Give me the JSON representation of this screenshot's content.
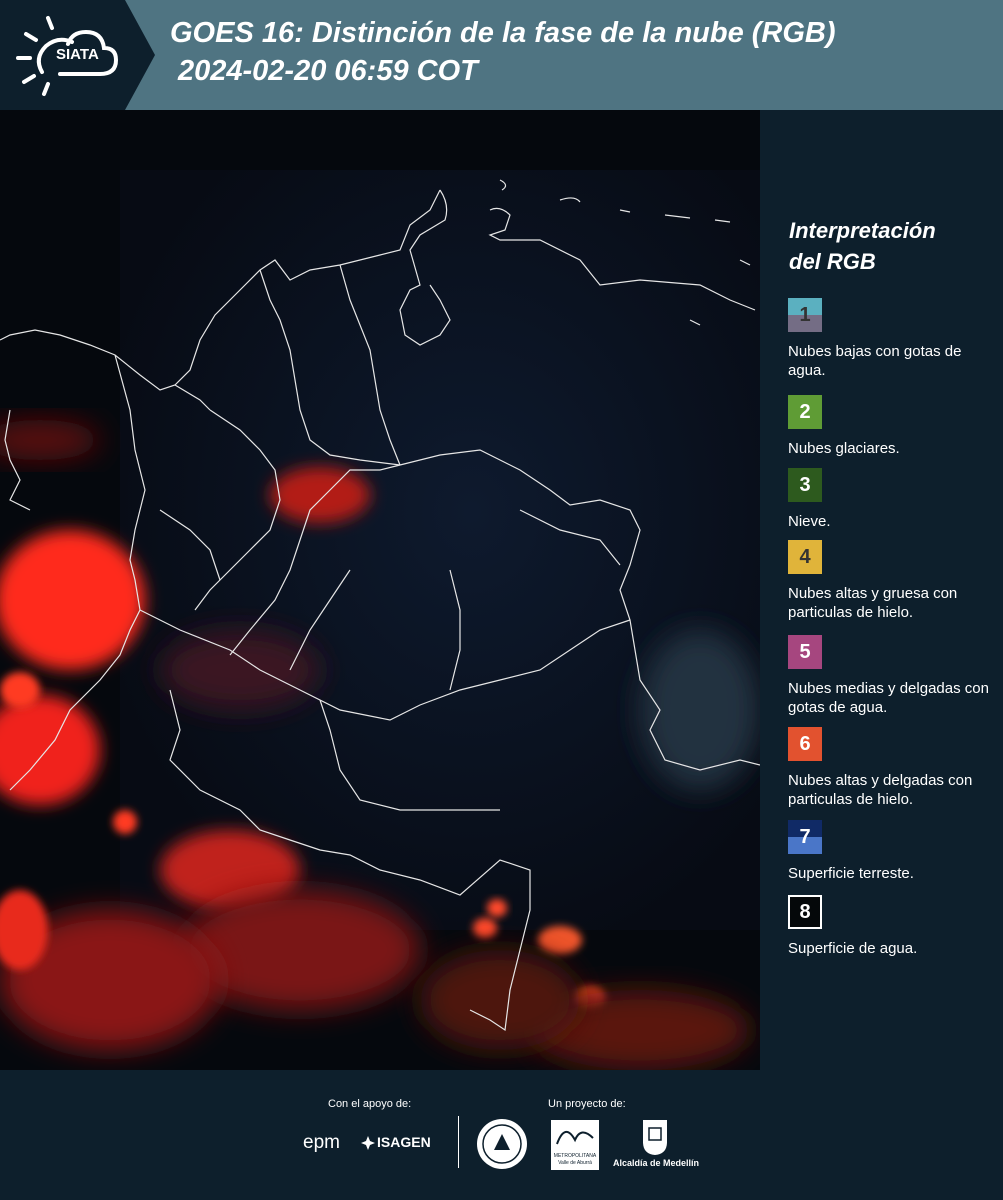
{
  "header": {
    "logo_text": "SIATA",
    "title_line1": "GOES 16: Distinción de la fase de la nube (RGB)",
    "title_line2": "2024-02-20 06:59 COT"
  },
  "legend": {
    "title_line1": "Interpretación",
    "title_line2": "del RGB",
    "items": [
      {
        "number": "1",
        "label": "Nubes bajas con gotas de agua.",
        "color_top": "#5bb0c0",
        "color_bottom": "#746d85"
      },
      {
        "number": "2",
        "label": "Nubes glaciares.",
        "color": "#5f9c35"
      },
      {
        "number": "3",
        "label": "Nieve.",
        "color": "#2d5a1e"
      },
      {
        "number": "4",
        "label": "Nubes altas y gruesa con particulas de hielo.",
        "color": "#e0b43a"
      },
      {
        "number": "5",
        "label": "Nubes medias y delgadas con gotas de agua.",
        "color": "#a6467f"
      },
      {
        "number": "6",
        "label": "Nubes altas y delgadas con particulas de hielo.",
        "color": "#e2522f"
      },
      {
        "number": "7",
        "label": "Superficie terreste.",
        "color_top": "#102a66",
        "color_bottom": "#4a76c8"
      },
      {
        "number": "8",
        "label": "Superficie de agua.",
        "color": "#05080a"
      }
    ]
  },
  "footer": {
    "support_label": "Con el apoyo de:",
    "project_label": "Un proyecto de:",
    "partner1": "epm",
    "partner2": "ISAGEN",
    "partner3_line1": "METROPOLITANA",
    "partner3_line2": "Valle de Aburrá",
    "partner4": "Alcaldía de Medellín"
  }
}
